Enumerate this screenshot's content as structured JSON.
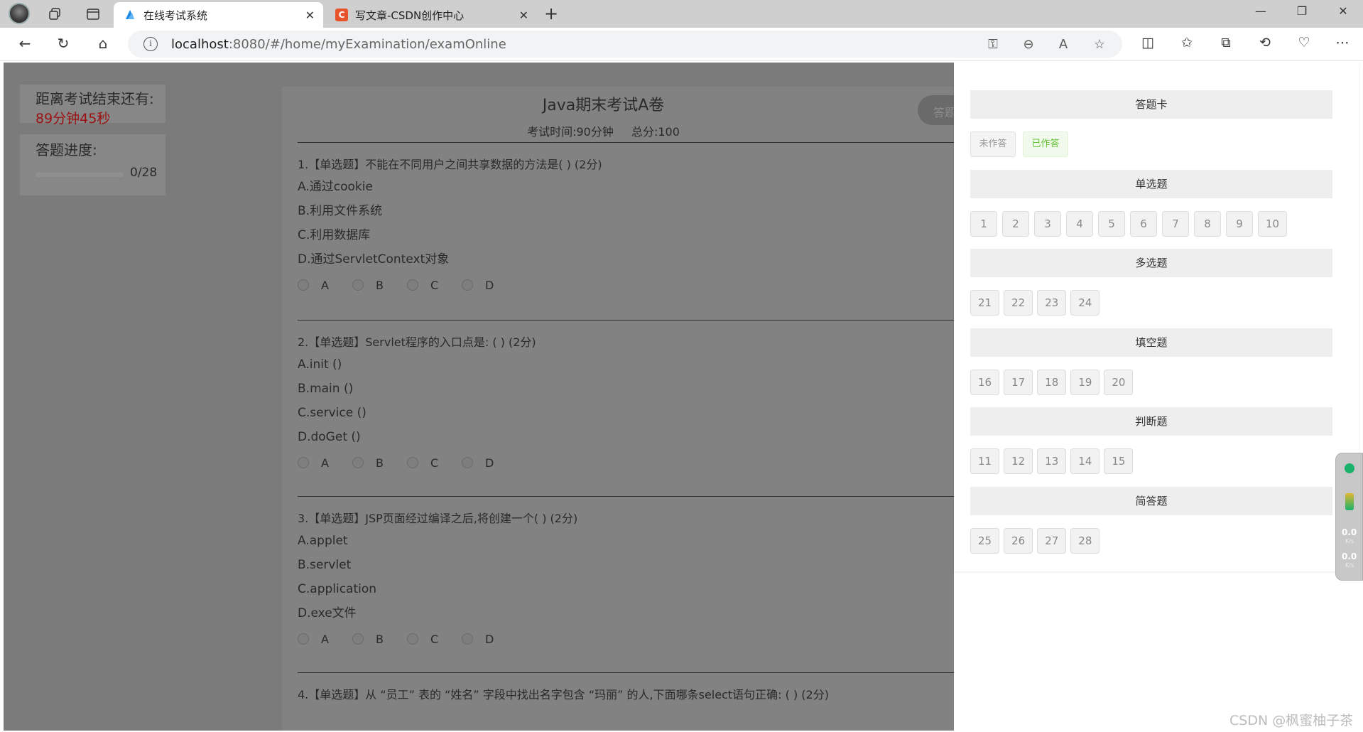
{
  "browser": {
    "tabs": [
      {
        "title": "在线考试系统",
        "active": true
      },
      {
        "title": "写文章-CSDN创作中心",
        "active": false
      }
    ],
    "address": {
      "host": "localhost",
      "path": ":8080/#/home/myExamination/examOnline"
    }
  },
  "sidebar": {
    "timer_label": "距离考试结束还有:",
    "timer_value": "89分钟45秒",
    "progress_label": "答题进度:",
    "progress_text": "0/28",
    "progress_fraction": 0
  },
  "paper": {
    "title": "Java期末考试A卷",
    "time_text": "考试时间:90分钟",
    "total_text": "总分:100",
    "submit_label": "答题",
    "questions": [
      {
        "title": "1.【单选题】不能在不同用户之间共享数据的方法是( ) (2分)",
        "options": [
          "A.通过cookie",
          "B.利用文件系统",
          "C.利用数据库",
          "D.通过ServletContext对象"
        ],
        "radios": [
          "A",
          "B",
          "C",
          "D"
        ]
      },
      {
        "title": "2.【单选题】Servlet程序的入口点是: ( ) (2分)",
        "options": [
          "A.init ()",
          "B.main ()",
          "C.service ()",
          "D.doGet ()"
        ],
        "radios": [
          "A",
          "B",
          "C",
          "D"
        ]
      },
      {
        "title": "3.【单选题】JSP页面经过编译之后,将创建一个( ) (2分)",
        "options": [
          "A.applet",
          "B.servlet",
          "C.application",
          "D.exe文件"
        ],
        "radios": [
          "A",
          "B",
          "C",
          "D"
        ]
      },
      {
        "title": "4.【单选题】从 “员工” 表的 “姓名” 字段中找出名字包含 “玛丽” 的人,下面哪条select语句正确: ( ) (2分)",
        "options": [],
        "radios": []
      }
    ]
  },
  "answer_card": {
    "title": "答题卡",
    "legend_unanswered": "未作答",
    "legend_answered": "已作答",
    "legend_answered_color": "#67c23a",
    "sections": [
      {
        "title": "单选题",
        "numbers": [
          "1",
          "2",
          "3",
          "4",
          "5",
          "6",
          "7",
          "8",
          "9",
          "10"
        ]
      },
      {
        "title": "多选题",
        "numbers": [
          "21",
          "22",
          "23",
          "24"
        ]
      },
      {
        "title": "填空题",
        "numbers": [
          "16",
          "17",
          "18",
          "19",
          "20"
        ]
      },
      {
        "title": "判断题",
        "numbers": [
          "11",
          "12",
          "13",
          "14",
          "15"
        ]
      },
      {
        "title": "简答题",
        "numbers": [
          "25",
          "26",
          "27",
          "28"
        ]
      }
    ]
  },
  "widget": {
    "up_value": "0.0",
    "up_unit": "K/s",
    "down_value": "0.0",
    "down_unit": "K/s"
  },
  "watermark": "CSDN @枫蜜柚子茶"
}
